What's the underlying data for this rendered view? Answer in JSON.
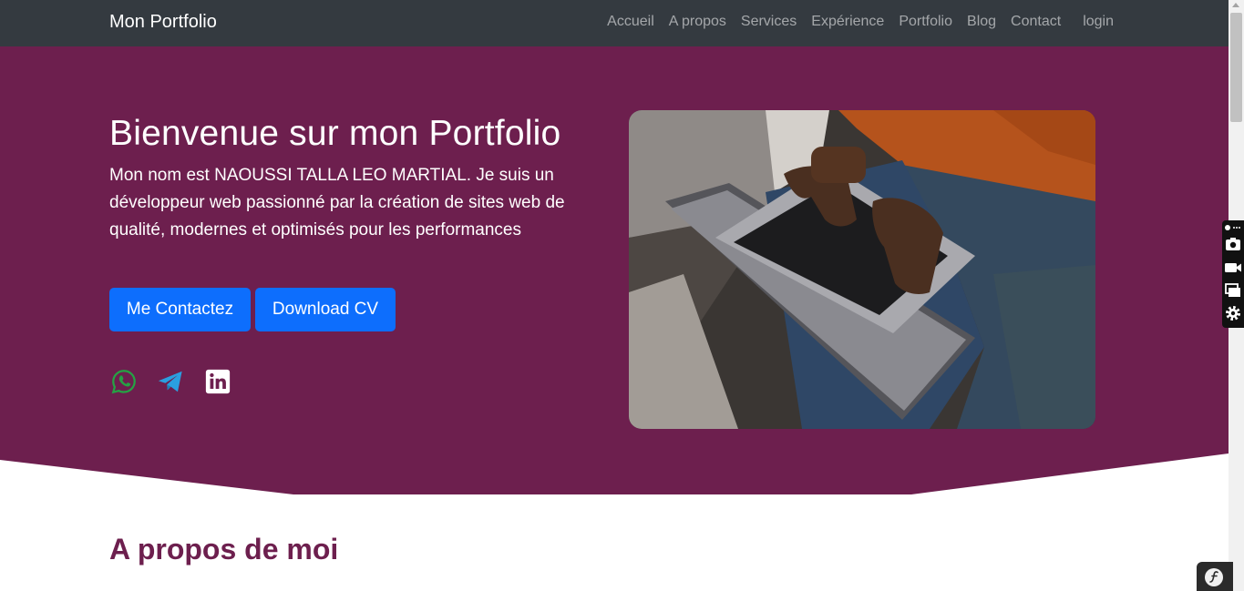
{
  "navbar": {
    "brand": "Mon Portfolio",
    "links": [
      {
        "label": "Accueil"
      },
      {
        "label": "A propos"
      },
      {
        "label": "Services"
      },
      {
        "label": "Expérience"
      },
      {
        "label": "Portfolio"
      },
      {
        "label": "Blog"
      },
      {
        "label": "Contact"
      }
    ],
    "login": "login"
  },
  "hero": {
    "title": "Bienvenue sur mon Portfolio",
    "description": "Mon nom est NAOUSSI TALLA LEO MARTIAL. Je suis un développeur web passionné par la création de sites web de qualité, modernes et optimisés pour les performances",
    "buttons": {
      "contact": "Me Contactez",
      "download": "Download CV"
    },
    "social_icons": [
      "whatsapp-icon",
      "telegram-icon",
      "linkedin-icon"
    ],
    "image": "laptop-typing-photo"
  },
  "about": {
    "title": "A propos de moi"
  },
  "devtools": {
    "icons": [
      "camera-icon",
      "video-icon",
      "windows-icon",
      "gear-icon"
    ],
    "badge_icon": "symfony-icon"
  },
  "colors": {
    "navbar": "#343a40",
    "hero": "#6d1f4e",
    "button": "#0d6efd",
    "whatsapp": "#25a244",
    "telegram": "#2a9fe0",
    "linkedin": "#ffffff"
  }
}
